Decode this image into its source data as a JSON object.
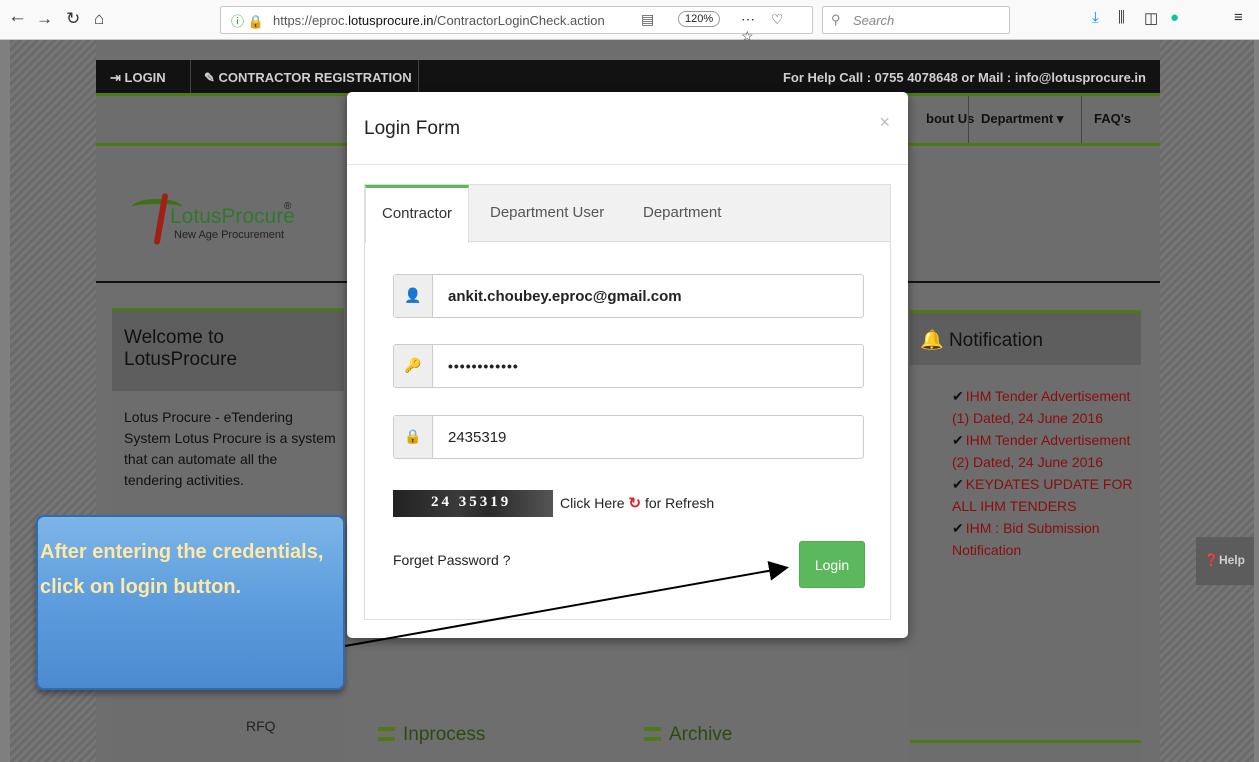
{
  "browser": {
    "url_prefix": "https://eproc.",
    "url_domain": "lotusprocure.in",
    "url_path": "/ContractorLoginCheck.action",
    "zoom": "120%",
    "search_placeholder": "Search"
  },
  "site": {
    "top_links": {
      "login": "LOGIN",
      "registration": "CONTRACTOR REGISTRATION"
    },
    "help_text": "For Help Call : 0755 4078648 or Mail : info@lotusprocure.in",
    "menu": {
      "about": "bout Us",
      "department": "Department",
      "faq": "FAQ's"
    },
    "logo": {
      "lotus": "Lotus",
      "procure": "Procure",
      "registered": "®",
      "tagline": "New Age Procurement"
    },
    "welcome": {
      "title": "Welcome to LotusProcure",
      "body": "Lotus Procure - eTendering System Lotus Procure is a system that can automate all the tendering activities.",
      "rfq": "RFQ"
    },
    "notification": {
      "title": "Notification",
      "items": [
        "IHM Tender Advertisement (1) Dated, 24 June 2016",
        "IHM Tender Advertisement (2) Dated, 24 June 2016",
        "KEYDATES UPDATE FOR ALL IHM TENDERS",
        "IHM : Bid Submission Notification"
      ]
    },
    "sections": {
      "inprocess": "Inprocess",
      "archive": "Archive"
    },
    "help_tab": "Help"
  },
  "modal": {
    "title": "Login Form",
    "close": "×",
    "tabs": [
      "Contractor",
      "Department User",
      "Department"
    ],
    "email": "ankit.choubey.eproc@gmail.com",
    "password": "123456789012",
    "captcha_input": "2435319",
    "captcha_image": "24 35319",
    "refresh_prefix": "Click Here",
    "refresh_suffix": "for Refresh",
    "forget": "Forget Password ?",
    "login": "Login"
  },
  "callout": {
    "text": "After entering the credentials, click on login button."
  },
  "colors": {
    "accent_green": "#5cb85c",
    "callout_blue": "#5d9ddd",
    "notification_red": "#8b0d0d"
  }
}
